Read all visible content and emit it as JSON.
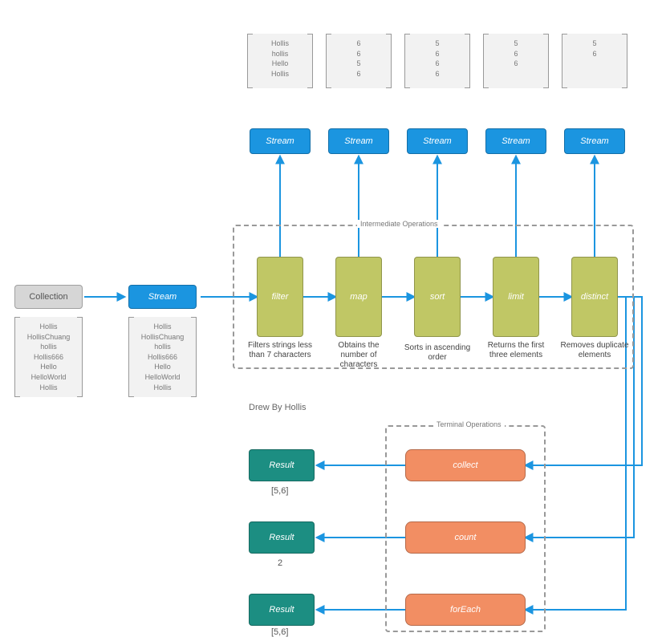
{
  "labels": {
    "collection": "Collection",
    "stream": "Stream",
    "intermediate_title": "Intermediate Operations",
    "terminal_title": "Terminal Operations",
    "credit": "Drew By Hollis",
    "result": "Result"
  },
  "source_list": [
    "Hollis",
    "HollisChuang",
    "hollis",
    "Hollis666",
    "Hello",
    "HelloWorld",
    "Hollis"
  ],
  "stream_copy_list": [
    "Hollis",
    "HollisChuang",
    "hollis",
    "Hollis666",
    "Hello",
    "HelloWorld",
    "Hollis"
  ],
  "top_streams": [
    {
      "data": [
        "Hollis",
        "hollis",
        "Hello",
        "Hollis"
      ]
    },
    {
      "data": [
        "6",
        "6",
        "5",
        "6"
      ]
    },
    {
      "data": [
        "5",
        "6",
        "6",
        "6"
      ]
    },
    {
      "data": [
        "5",
        "6",
        "6"
      ]
    },
    {
      "data": [
        "5",
        "6"
      ]
    }
  ],
  "ops": [
    {
      "name": "filter",
      "caption": "Filters strings less than 7 characters"
    },
    {
      "name": "map",
      "caption": "Obtains the number of characters"
    },
    {
      "name": "sort",
      "caption": "Sorts in ascending order"
    },
    {
      "name": "limit",
      "caption": "Returns the first three elements"
    },
    {
      "name": "distinct",
      "caption": "Removes duplicate elements"
    }
  ],
  "terminals": [
    {
      "name": "collect",
      "result": "[5,6]"
    },
    {
      "name": "count",
      "result": "2"
    },
    {
      "name": "forEach",
      "result": "[5,6]"
    }
  ]
}
